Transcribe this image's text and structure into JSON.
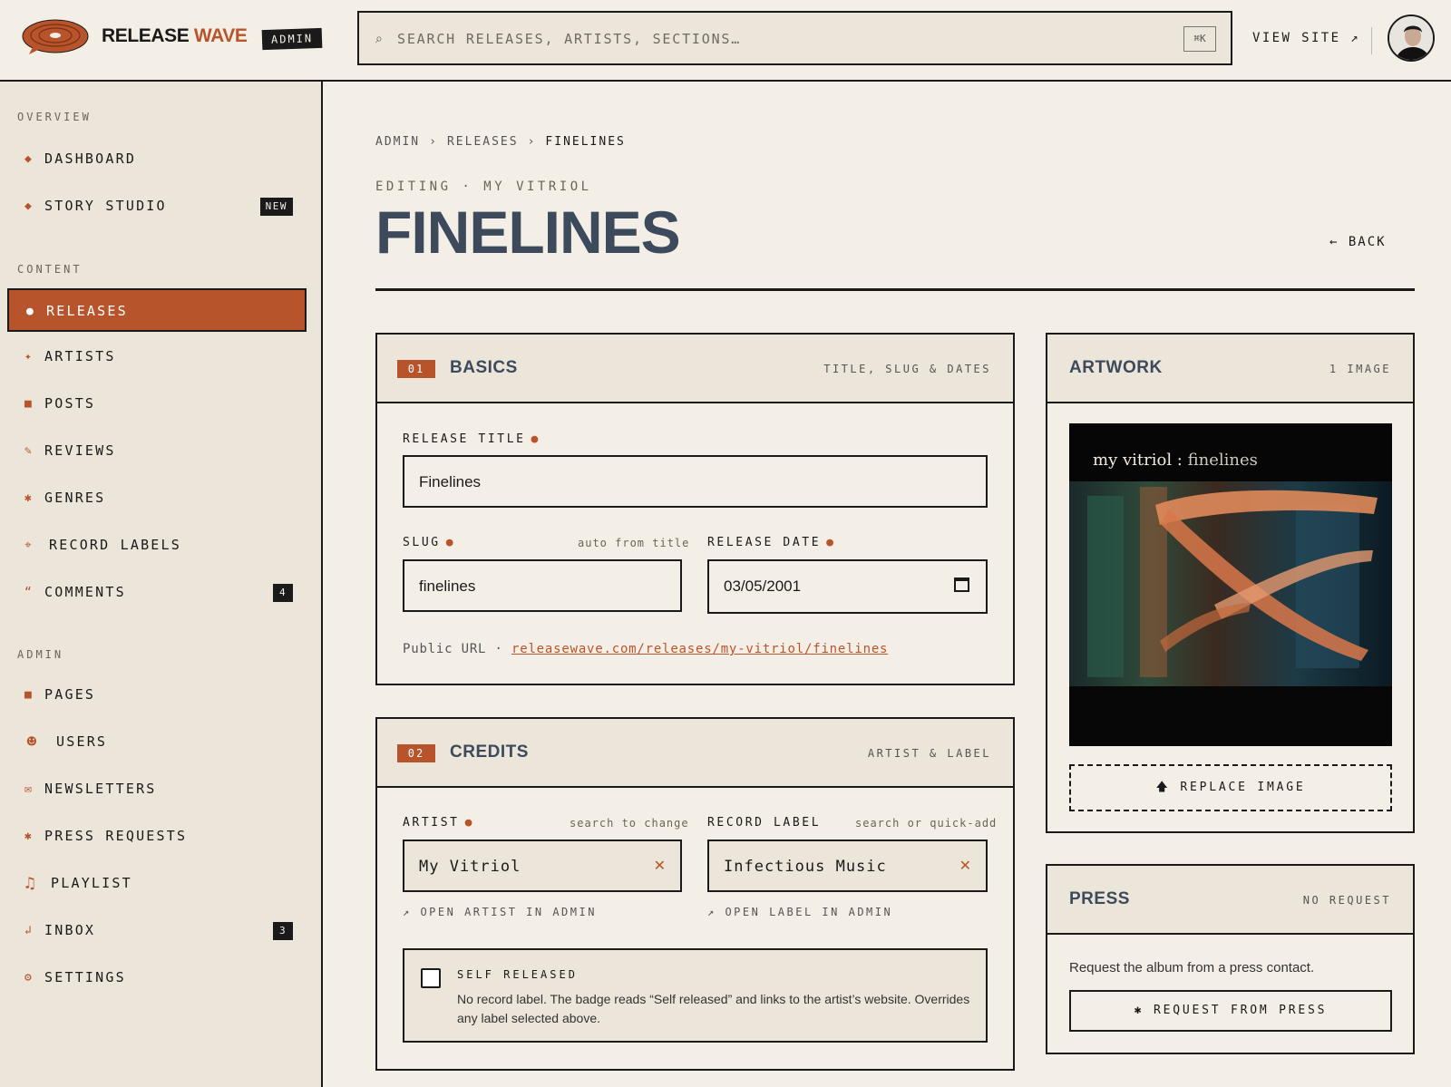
{
  "app": {
    "brand_word1": "RELEASE",
    "brand_word2": "WAVE",
    "admin_tag": "ADMIN",
    "search_placeholder": "SEARCH RELEASES, ARTISTS, SECTIONS…",
    "search_shortcut": "⌘K",
    "view_site": "VIEW SITE ↗"
  },
  "sidebar": {
    "sections": [
      {
        "label": "OVERVIEW",
        "items": [
          {
            "label": "DASHBOARD",
            "icon": "diamond-icon",
            "glyph": "◆"
          },
          {
            "label": "STORY STUDIO",
            "icon": "diamond-icon",
            "glyph": "◆",
            "badge": "NEW"
          }
        ]
      },
      {
        "label": "CONTENT",
        "items": [
          {
            "label": "RELEASES",
            "icon": "dot-icon",
            "glyph": "●",
            "active": true
          },
          {
            "label": "ARTISTS",
            "icon": "sparkle-icon",
            "glyph": "✦"
          },
          {
            "label": "POSTS",
            "icon": "square-icon",
            "glyph": "■"
          },
          {
            "label": "REVIEWS",
            "icon": "pencil-icon",
            "glyph": "✎"
          },
          {
            "label": "GENRES",
            "icon": "asterisk-icon",
            "glyph": "✱"
          },
          {
            "label": "RECORD LABELS",
            "icon": "crosshair-icon",
            "glyph": "⌖"
          },
          {
            "label": "COMMENTS",
            "icon": "quote-icon",
            "glyph": "“",
            "badge": "4"
          }
        ]
      },
      {
        "label": "ADMIN",
        "items": [
          {
            "label": "PAGES",
            "icon": "square-icon",
            "glyph": "■"
          },
          {
            "label": "USERS",
            "icon": "smiley-icon",
            "glyph": "☻"
          },
          {
            "label": "NEWSLETTERS",
            "icon": "envelope-icon",
            "glyph": "✉"
          },
          {
            "label": "PRESS REQUESTS",
            "icon": "asterisk-icon",
            "glyph": "✱"
          },
          {
            "label": "PLAYLIST",
            "icon": "music-note-icon",
            "glyph": "♫"
          },
          {
            "label": "INBOX",
            "icon": "inbox-icon",
            "glyph": "↲",
            "badge": "3"
          },
          {
            "label": "SETTINGS",
            "icon": "gear-icon",
            "glyph": "⚙"
          }
        ]
      }
    ]
  },
  "breadcrumb": {
    "items": [
      "ADMIN",
      "RELEASES",
      "FINELINES"
    ],
    "separator": "›"
  },
  "header": {
    "editing": "EDITING · MY VITRIOL",
    "title": "FINELINES",
    "back": "← BACK"
  },
  "basics": {
    "num": "01",
    "title": "BASICS",
    "meta": "TITLE, SLUG & DATES",
    "release_title_label": "RELEASE TITLE",
    "release_title_value": "Finelines",
    "slug_label": "SLUG",
    "slug_hint": "auto from title",
    "slug_value": "finelines",
    "date_label": "RELEASE DATE",
    "date_value": "03/05/2001",
    "public_url_label": "Public URL ·",
    "public_url": "releasewave.com/releases/my-vitriol/finelines"
  },
  "credits": {
    "num": "02",
    "title": "CREDITS",
    "meta": "ARTIST & LABEL",
    "artist_label": "ARTIST",
    "artist_hint": "search to change",
    "artist_value": "My Vitriol",
    "artist_link": "↗ OPEN ARTIST IN ADMIN",
    "label_label": "RECORD LABEL",
    "label_hint": "search or quick-add",
    "label_value": "Infectious Music",
    "label_link": "↗ OPEN LABEL IN ADMIN",
    "self_title": "SELF RELEASED",
    "self_desc": "No record label. The badge reads “Self released” and links to the artist’s website. Overrides any label selected above.",
    "self_checked": false
  },
  "artwork": {
    "title": "ARTWORK",
    "meta": "1 IMAGE",
    "caption_artist": "my vitriol :",
    "caption_album": "finelines",
    "replace": "REPLACE IMAGE"
  },
  "press": {
    "title": "PRESS",
    "meta": "NO REQUEST",
    "text": "Request the album from a press contact.",
    "button": "✱ REQUEST FROM PRESS"
  },
  "colors": {
    "accent": "#b8542b",
    "ink": "#1a1a1a",
    "paper": "#f4efe6",
    "title_slate": "#3d4a5c"
  }
}
